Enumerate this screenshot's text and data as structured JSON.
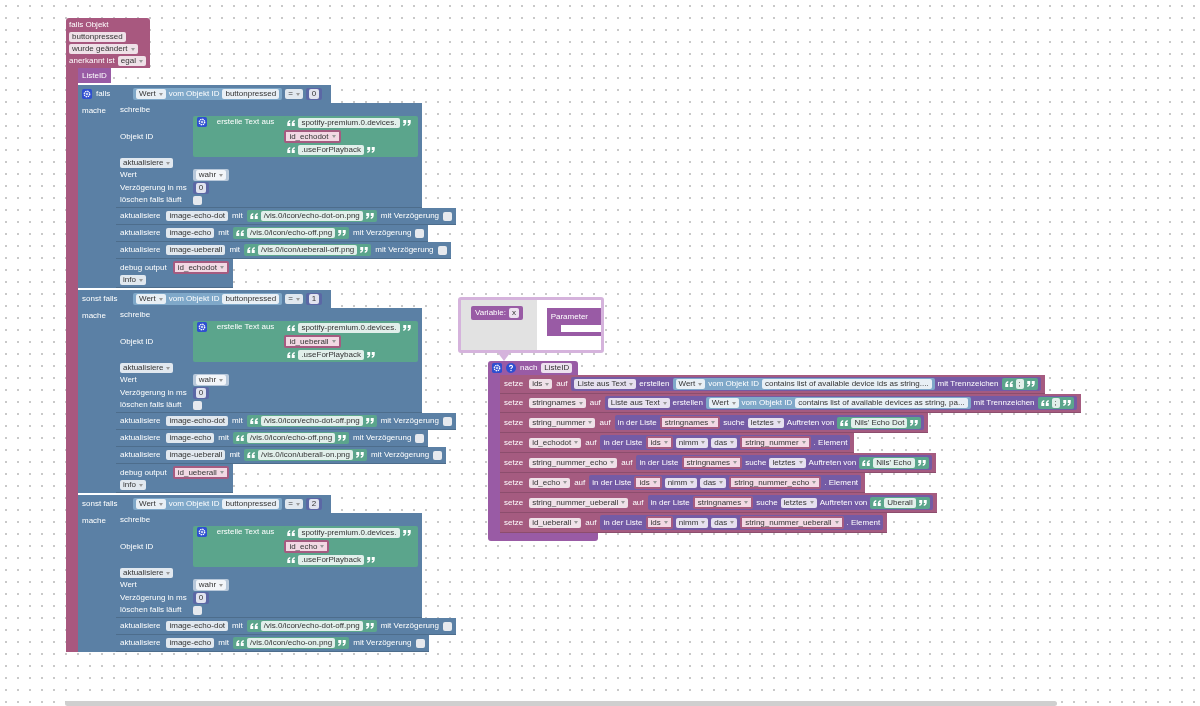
{
  "trigger": {
    "rows": [
      [
        {
          "kind": "text",
          "text": "falls Objekt"
        }
      ],
      [
        {
          "kind": "field",
          "text": "buttonpressed"
        }
      ],
      [
        {
          "kind": "dropdown",
          "text": "wurde geändert"
        }
      ],
      [
        {
          "kind": "text",
          "text": "anerkannt ist"
        },
        {
          "kind": "dropdown",
          "text": "egal"
        }
      ]
    ]
  },
  "call": {
    "name": "ListeID"
  },
  "branches": [
    {
      "keyword": "falls",
      "condition": {
        "kind": "logic_block",
        "tokens": [
          {
            "kind": "state_block",
            "tokens": [
              {
                "kind": "dropdown",
                "text": "Wert"
              },
              {
                "kind": "text",
                "text": "vom Objekt ID"
              },
              {
                "kind": "field",
                "text": "buttonpressed"
              }
            ]
          },
          {
            "kind": "dropdown",
            "text": "="
          },
          {
            "kind": "math_block",
            "tokens": [
              {
                "kind": "field",
                "text": "0"
              }
            ]
          }
        ]
      },
      "do_label": "mache",
      "statements": [
        {
          "kind": "io",
          "rows": [
            [
              {
                "kind": "text",
                "text": "schreibe"
              }
            ],
            [
              {
                "kind": "text",
                "text": "Objekt ID"
              },
              {
                "kind": "join",
                "label": "erstelle Text aus",
                "items": [
                  {
                    "kind": "string",
                    "text": "spotify-premium.0.devices."
                  },
                  {
                    "kind": "var",
                    "text": "id_echodot"
                  },
                  {
                    "kind": "string",
                    "text": ".useForPlayback"
                  }
                ]
              }
            ],
            [
              {
                "kind": "dropdown",
                "text": "aktualisiere"
              }
            ],
            [
              {
                "kind": "text",
                "text": "Wert"
              },
              {
                "kind": "bool_block",
                "tokens": [
                  {
                    "kind": "dropdown",
                    "text": "wahr"
                  }
                ]
              }
            ],
            [
              {
                "kind": "text",
                "text": "Verzögerung in ms"
              },
              {
                "kind": "math_block",
                "tokens": [
                  {
                    "kind": "field",
                    "text": "0"
                  }
                ]
              }
            ],
            [
              {
                "kind": "text",
                "text": "löschen falls läuft"
              },
              {
                "kind": "check",
                "checked": false
              }
            ]
          ]
        },
        {
          "kind": "io",
          "rows": [
            [
              {
                "kind": "text",
                "text": "aktualisiere"
              },
              {
                "kind": "field",
                "text": "image-echo-dot"
              },
              {
                "kind": "text",
                "text": "mit"
              },
              {
                "kind": "string",
                "text": "/vis.0/icon/echo-dot-on.png"
              },
              {
                "kind": "text",
                "text": "mit Verzögerung"
              },
              {
                "kind": "check",
                "checked": false
              }
            ]
          ]
        },
        {
          "kind": "io",
          "rows": [
            [
              {
                "kind": "text",
                "text": "aktualisiere"
              },
              {
                "kind": "field",
                "text": "image-echo"
              },
              {
                "kind": "text",
                "text": "mit"
              },
              {
                "kind": "string",
                "text": "/vis.0/icon/echo-off.png"
              },
              {
                "kind": "text",
                "text": "mit Verzögerung"
              },
              {
                "kind": "check",
                "checked": false
              }
            ]
          ]
        },
        {
          "kind": "io",
          "rows": [
            [
              {
                "kind": "text",
                "text": "aktualisiere"
              },
              {
                "kind": "field",
                "text": "image-ueberall"
              },
              {
                "kind": "text",
                "text": "mit"
              },
              {
                "kind": "string",
                "text": "/vis.0/icon/ueberall-off.png"
              },
              {
                "kind": "text",
                "text": "mit Verzögerung"
              },
              {
                "kind": "check",
                "checked": false
              }
            ]
          ]
        },
        {
          "kind": "io",
          "rows": [
            [
              {
                "kind": "text",
                "text": "debug output"
              },
              {
                "kind": "var",
                "text": "id_echodot"
              }
            ],
            [
              {
                "kind": "dropdown",
                "text": "info"
              }
            ]
          ]
        }
      ]
    },
    {
      "keyword": "sonst falls",
      "condition": {
        "kind": "logic_block",
        "tokens": [
          {
            "kind": "state_block",
            "tokens": [
              {
                "kind": "dropdown",
                "text": "Wert"
              },
              {
                "kind": "text",
                "text": "vom Objekt ID"
              },
              {
                "kind": "field",
                "text": "buttonpressed"
              }
            ]
          },
          {
            "kind": "dropdown",
            "text": "="
          },
          {
            "kind": "math_block",
            "tokens": [
              {
                "kind": "field",
                "text": "1"
              }
            ]
          }
        ]
      },
      "do_label": "mache",
      "statements": [
        {
          "kind": "io",
          "rows": [
            [
              {
                "kind": "text",
                "text": "schreibe"
              }
            ],
            [
              {
                "kind": "text",
                "text": "Objekt ID"
              },
              {
                "kind": "join",
                "label": "erstelle Text aus",
                "items": [
                  {
                    "kind": "string",
                    "text": "spotify-premium.0.devices."
                  },
                  {
                    "kind": "var",
                    "text": "id_ueberall"
                  },
                  {
                    "kind": "string",
                    "text": ".useForPlayback"
                  }
                ]
              }
            ],
            [
              {
                "kind": "dropdown",
                "text": "aktualisiere"
              }
            ],
            [
              {
                "kind": "text",
                "text": "Wert"
              },
              {
                "kind": "bool_block",
                "tokens": [
                  {
                    "kind": "dropdown",
                    "text": "wahr"
                  }
                ]
              }
            ],
            [
              {
                "kind": "text",
                "text": "Verzögerung in ms"
              },
              {
                "kind": "math_block",
                "tokens": [
                  {
                    "kind": "field",
                    "text": "0"
                  }
                ]
              }
            ],
            [
              {
                "kind": "text",
                "text": "löschen falls läuft"
              },
              {
                "kind": "check",
                "checked": false
              }
            ]
          ]
        },
        {
          "kind": "io",
          "rows": [
            [
              {
                "kind": "text",
                "text": "aktualisiere"
              },
              {
                "kind": "field",
                "text": "image-echo-dot"
              },
              {
                "kind": "text",
                "text": "mit"
              },
              {
                "kind": "string",
                "text": "/vis.0/icon/echo-dot-off.png"
              },
              {
                "kind": "text",
                "text": "mit Verzögerung"
              },
              {
                "kind": "check",
                "checked": false
              }
            ]
          ]
        },
        {
          "kind": "io",
          "rows": [
            [
              {
                "kind": "text",
                "text": "aktualisiere"
              },
              {
                "kind": "field",
                "text": "image-echo"
              },
              {
                "kind": "text",
                "text": "mit"
              },
              {
                "kind": "string",
                "text": "/vis.0/icon/echo-off.png"
              },
              {
                "kind": "text",
                "text": "mit Verzögerung"
              },
              {
                "kind": "check",
                "checked": false
              }
            ]
          ]
        },
        {
          "kind": "io",
          "rows": [
            [
              {
                "kind": "text",
                "text": "aktualisiere"
              },
              {
                "kind": "field",
                "text": "image-ueberall"
              },
              {
                "kind": "text",
                "text": "mit"
              },
              {
                "kind": "string",
                "text": "/vis.0/icon/uberall-on.png"
              },
              {
                "kind": "text",
                "text": "mit Verzögerung"
              },
              {
                "kind": "check",
                "checked": false
              }
            ]
          ]
        },
        {
          "kind": "io",
          "rows": [
            [
              {
                "kind": "text",
                "text": "debug output"
              },
              {
                "kind": "var",
                "text": "id_ueberall"
              }
            ],
            [
              {
                "kind": "dropdown",
                "text": "info"
              }
            ]
          ]
        }
      ]
    },
    {
      "keyword": "sonst falls",
      "condition": {
        "kind": "logic_block",
        "tokens": [
          {
            "kind": "state_block",
            "tokens": [
              {
                "kind": "dropdown",
                "text": "Wert"
              },
              {
                "kind": "text",
                "text": "vom Objekt ID"
              },
              {
                "kind": "field",
                "text": "buttonpressed"
              }
            ]
          },
          {
            "kind": "dropdown",
            "text": "="
          },
          {
            "kind": "math_block",
            "tokens": [
              {
                "kind": "field",
                "text": "2"
              }
            ]
          }
        ]
      },
      "do_label": "mache",
      "statements": [
        {
          "kind": "io",
          "rows": [
            [
              {
                "kind": "text",
                "text": "schreibe"
              }
            ],
            [
              {
                "kind": "text",
                "text": "Objekt ID"
              },
              {
                "kind": "join",
                "label": "erstelle Text aus",
                "items": [
                  {
                    "kind": "string",
                    "text": "spotify-premium.0.devices."
                  },
                  {
                    "kind": "var",
                    "text": "id_echo"
                  },
                  {
                    "kind": "string",
                    "text": ".useForPlayback"
                  }
                ]
              }
            ],
            [
              {
                "kind": "dropdown",
                "text": "aktualisiere"
              }
            ],
            [
              {
                "kind": "text",
                "text": "Wert"
              },
              {
                "kind": "bool_block",
                "tokens": [
                  {
                    "kind": "dropdown",
                    "text": "wahr"
                  }
                ]
              }
            ],
            [
              {
                "kind": "text",
                "text": "Verzögerung in ms"
              },
              {
                "kind": "math_block",
                "tokens": [
                  {
                    "kind": "field",
                    "text": "0"
                  }
                ]
              }
            ],
            [
              {
                "kind": "text",
                "text": "löschen falls läuft"
              },
              {
                "kind": "check",
                "checked": false
              }
            ]
          ]
        },
        {
          "kind": "io",
          "rows": [
            [
              {
                "kind": "text",
                "text": "aktualisiere"
              },
              {
                "kind": "field",
                "text": "image-echo-dot"
              },
              {
                "kind": "text",
                "text": "mit"
              },
              {
                "kind": "string",
                "text": "/vis.0/icon/echo-dot-off.png"
              },
              {
                "kind": "text",
                "text": "mit Verzögerung"
              },
              {
                "kind": "check",
                "checked": false
              }
            ]
          ]
        },
        {
          "kind": "io",
          "rows": [
            [
              {
                "kind": "text",
                "text": "aktualisiere"
              },
              {
                "kind": "field",
                "text": "image-echo"
              },
              {
                "kind": "text",
                "text": "mit"
              },
              {
                "kind": "string",
                "text": "/vis.0/icon/echo-on.png"
              },
              {
                "kind": "text",
                "text": "mit Verzögerung"
              },
              {
                "kind": "check",
                "checked": false
              }
            ]
          ]
        }
      ]
    }
  ],
  "procedure": {
    "mutator": {
      "variable_label": "Variable:",
      "variable": "x",
      "container_label": "Parameter"
    },
    "title": "nach",
    "name": "ListeID",
    "statements": [
      {
        "kind": "variables",
        "rows": [
          [
            {
              "kind": "text",
              "text": "setze"
            },
            {
              "kind": "dropdown",
              "text": "ids"
            },
            {
              "kind": "text",
              "text": "auf"
            },
            {
              "kind": "lists_block",
              "tokens": [
                {
                  "kind": "dropdown",
                  "text": "Liste aus Text"
                },
                {
                  "kind": "text",
                  "text": "erstellen"
                },
                {
                  "kind": "state_block",
                  "tokens": [
                    {
                      "kind": "dropdown",
                      "text": "Wert"
                    },
                    {
                      "kind": "text",
                      "text": "vom Objekt ID"
                    },
                    {
                      "kind": "field",
                      "text": "contains list of available device ids as string...."
                    }
                  ]
                },
                {
                  "kind": "text",
                  "text": "mit Trennzeichen"
                },
                {
                  "kind": "string",
                  "text": ";"
                }
              ]
            }
          ]
        ]
      },
      {
        "kind": "variables",
        "rows": [
          [
            {
              "kind": "text",
              "text": "setze"
            },
            {
              "kind": "dropdown",
              "text": "stringnames"
            },
            {
              "kind": "text",
              "text": "auf"
            },
            {
              "kind": "lists_block",
              "tokens": [
                {
                  "kind": "dropdown",
                  "text": "Liste aus Text"
                },
                {
                  "kind": "text",
                  "text": "erstellen"
                },
                {
                  "kind": "state_block",
                  "tokens": [
                    {
                      "kind": "dropdown",
                      "text": "Wert"
                    },
                    {
                      "kind": "text",
                      "text": "vom Objekt ID"
                    },
                    {
                      "kind": "field",
                      "text": "contains list of available devices as string, pa..."
                    }
                  ]
                },
                {
                  "kind": "text",
                  "text": "mit Trennzeichen"
                },
                {
                  "kind": "string",
                  "text": ";"
                }
              ]
            }
          ]
        ]
      },
      {
        "kind": "variables",
        "rows": [
          [
            {
              "kind": "text",
              "text": "setze"
            },
            {
              "kind": "dropdown",
              "text": "string_nummer"
            },
            {
              "kind": "text",
              "text": "auf"
            },
            {
              "kind": "lists_block",
              "tokens": [
                {
                  "kind": "text",
                  "text": "in der Liste"
                },
                {
                  "kind": "var",
                  "text": "stringnames"
                },
                {
                  "kind": "text",
                  "text": "suche"
                },
                {
                  "kind": "dropdown",
                  "text": "letztes"
                },
                {
                  "kind": "text",
                  "text": "Auftreten von"
                },
                {
                  "kind": "string",
                  "text": "Nils' Echo Dot"
                }
              ]
            }
          ]
        ]
      },
      {
        "kind": "variables",
        "rows": [
          [
            {
              "kind": "text",
              "text": "setze"
            },
            {
              "kind": "dropdown",
              "text": "id_echodot"
            },
            {
              "kind": "text",
              "text": "auf"
            },
            {
              "kind": "lists_block",
              "tokens": [
                {
                  "kind": "text",
                  "text": "in der Liste"
                },
                {
                  "kind": "var",
                  "text": "ids"
                },
                {
                  "kind": "dropdown",
                  "text": "nimm"
                },
                {
                  "kind": "dropdown",
                  "text": "das"
                },
                {
                  "kind": "var",
                  "text": "string_nummer"
                },
                {
                  "kind": "text",
                  "text": ". Element"
                }
              ]
            }
          ]
        ]
      },
      {
        "kind": "variables",
        "rows": [
          [
            {
              "kind": "text",
              "text": "setze"
            },
            {
              "kind": "dropdown",
              "text": "string_nummer_echo"
            },
            {
              "kind": "text",
              "text": "auf"
            },
            {
              "kind": "lists_block",
              "tokens": [
                {
                  "kind": "text",
                  "text": "in der Liste"
                },
                {
                  "kind": "var",
                  "text": "stringnames"
                },
                {
                  "kind": "text",
                  "text": "suche"
                },
                {
                  "kind": "dropdown",
                  "text": "letztes"
                },
                {
                  "kind": "text",
                  "text": "Auftreten von"
                },
                {
                  "kind": "string",
                  "text": "Nils' Echo"
                }
              ]
            }
          ]
        ]
      },
      {
        "kind": "variables",
        "rows": [
          [
            {
              "kind": "text",
              "text": "setze"
            },
            {
              "kind": "dropdown",
              "text": "id_echo"
            },
            {
              "kind": "text",
              "text": "auf"
            },
            {
              "kind": "lists_block",
              "tokens": [
                {
                  "kind": "text",
                  "text": "in der Liste"
                },
                {
                  "kind": "var",
                  "text": "ids"
                },
                {
                  "kind": "dropdown",
                  "text": "nimm"
                },
                {
                  "kind": "dropdown",
                  "text": "das"
                },
                {
                  "kind": "var",
                  "text": "string_nummer_echo"
                },
                {
                  "kind": "text",
                  "text": ". Element"
                }
              ]
            }
          ]
        ]
      },
      {
        "kind": "variables",
        "rows": [
          [
            {
              "kind": "text",
              "text": "setze"
            },
            {
              "kind": "dropdown",
              "text": "string_nummer_ueberall"
            },
            {
              "kind": "text",
              "text": "auf"
            },
            {
              "kind": "lists_block",
              "tokens": [
                {
                  "kind": "text",
                  "text": "in der Liste"
                },
                {
                  "kind": "var",
                  "text": "stringnames"
                },
                {
                  "kind": "text",
                  "text": "suche"
                },
                {
                  "kind": "dropdown",
                  "text": "letztes"
                },
                {
                  "kind": "text",
                  "text": "Auftreten von"
                },
                {
                  "kind": "string",
                  "text": "Uberall"
                }
              ]
            }
          ]
        ]
      },
      {
        "kind": "variables",
        "rows": [
          [
            {
              "kind": "text",
              "text": "setze"
            },
            {
              "kind": "dropdown",
              "text": "id_ueberall"
            },
            {
              "kind": "text",
              "text": "auf"
            },
            {
              "kind": "lists_block",
              "tokens": [
                {
                  "kind": "text",
                  "text": "in der Liste"
                },
                {
                  "kind": "var",
                  "text": "ids"
                },
                {
                  "kind": "dropdown",
                  "text": "nimm"
                },
                {
                  "kind": "dropdown",
                  "text": "das"
                },
                {
                  "kind": "var",
                  "text": "string_nummer_ueberall"
                },
                {
                  "kind": "text",
                  "text": ". Element"
                }
              ]
            }
          ]
        ]
      }
    ]
  }
}
